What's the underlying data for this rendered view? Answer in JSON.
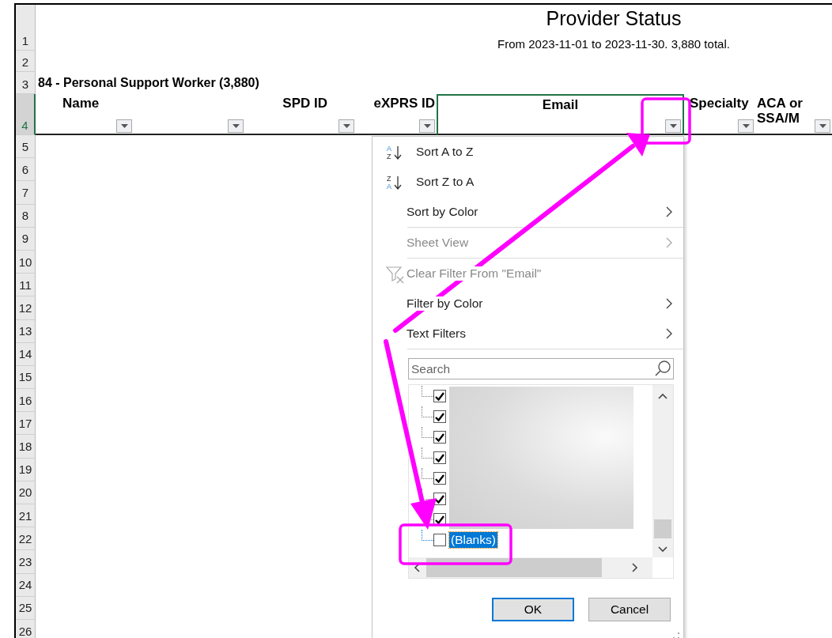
{
  "sheet": {
    "title": "Provider Status",
    "subtitle": "From 2023-11-01 to 2023-11-30. 3,880 total.",
    "group_heading": "84 - Personal Support Worker (3,880)",
    "columns": [
      {
        "label": "Name",
        "selected": false
      },
      {
        "selected": false
      },
      {
        "label": "SPD ID",
        "selected": false
      },
      {
        "label": "eXPRS ID",
        "selected": false
      },
      {
        "label": "Email",
        "selected": true
      },
      {
        "label": "Specialty",
        "selected": false
      },
      {
        "label": "ACA or SSA/M",
        "selected": false
      }
    ],
    "rows": [
      {
        "label": "1",
        "selected": false
      },
      {
        "label": "2",
        "selected": false
      },
      {
        "label": "3",
        "selected": false
      },
      {
        "label": "4",
        "selected": true
      },
      {
        "label": "5",
        "selected": false
      },
      {
        "label": "6",
        "selected": false
      },
      {
        "label": "7",
        "selected": false
      },
      {
        "label": "8",
        "selected": false
      },
      {
        "label": "9",
        "selected": false
      },
      {
        "label": "10",
        "selected": false
      },
      {
        "label": "11",
        "selected": false
      },
      {
        "label": "12",
        "selected": false
      },
      {
        "label": "13",
        "selected": false
      },
      {
        "label": "14",
        "selected": false
      },
      {
        "label": "15",
        "selected": false
      },
      {
        "label": "16",
        "selected": false
      },
      {
        "label": "17",
        "selected": false
      },
      {
        "label": "18",
        "selected": false
      },
      {
        "label": "19",
        "selected": false
      },
      {
        "label": "20",
        "selected": false
      },
      {
        "label": "21",
        "selected": false
      },
      {
        "label": "22",
        "selected": false
      },
      {
        "label": "23",
        "selected": false
      },
      {
        "label": "24",
        "selected": false
      },
      {
        "label": "25",
        "selected": false
      },
      {
        "label": "26",
        "selected": false
      }
    ]
  },
  "filter_menu": {
    "items": [
      {
        "kind": "sort_ascending",
        "label": "Sort A to Z",
        "icon_letters": [
          "A",
          "Z"
        ],
        "disabled": false
      },
      {
        "kind": "sort_descending",
        "label": "Sort Z to A",
        "icon_letters": [
          "Z",
          "A"
        ],
        "disabled": false
      },
      {
        "kind": "submenu",
        "label": "Sort by Color",
        "disabled": false
      },
      {
        "kind": "separator"
      },
      {
        "kind": "submenu",
        "label": "Sheet View",
        "disabled": true
      },
      {
        "kind": "separator"
      },
      {
        "kind": "clear_filter",
        "label": "Clear Filter From \"Email\"",
        "disabled": true
      },
      {
        "kind": "submenu",
        "label": "Filter by Color",
        "disabled": false
      },
      {
        "kind": "submenu",
        "label": "Text Filters",
        "disabled": false
      },
      {
        "kind": "separator"
      }
    ],
    "search": {
      "placeholder": "Search"
    },
    "values": [
      {
        "checked": true,
        "selected": false
      },
      {
        "checked": true,
        "selected": false
      },
      {
        "checked": true,
        "selected": false
      },
      {
        "checked": true,
        "selected": false
      },
      {
        "checked": true,
        "selected": false
      },
      {
        "checked": true,
        "selected": false
      },
      {
        "checked": true,
        "selected": false
      },
      {
        "label": "(Blanks)",
        "checked": false,
        "selected": true
      }
    ],
    "buttons": [
      {
        "label": "OK",
        "default": true
      },
      {
        "label": "Cancel",
        "default": false
      }
    ]
  }
}
